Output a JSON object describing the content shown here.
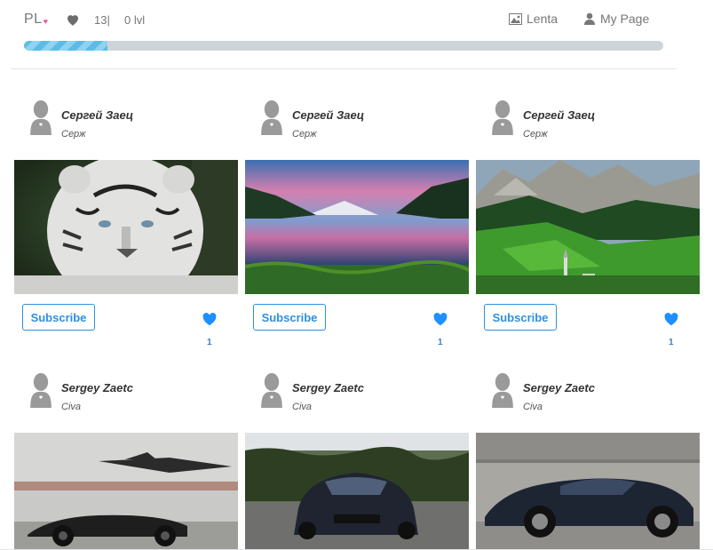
{
  "header": {
    "logo": "PL",
    "likes_count": "13|",
    "level": "0 lvl",
    "nav": [
      {
        "label": "Lenta",
        "icon": "image-icon"
      },
      {
        "label": "My Page",
        "icon": "user-icon"
      }
    ],
    "progress": 0.13
  },
  "colors": {
    "accent": "#2f8fe0",
    "progress_fill": "#5bbde3",
    "progress_track": "#cdd5d9",
    "logo_heart": "#e6559a"
  },
  "posts": [
    {
      "author_name": "Сергей Заец",
      "author_nick": "Серж",
      "photo": "white-tiger",
      "subscribe_label": "Subscribe",
      "likes": "1"
    },
    {
      "author_name": "Сергей Заец",
      "author_nick": "Серж",
      "photo": "mountain-lake-sunset",
      "subscribe_label": "Subscribe",
      "likes": "1"
    },
    {
      "author_name": "Сергей Заец",
      "author_nick": "Серж",
      "photo": "alpine-valley",
      "subscribe_label": "Subscribe",
      "likes": "1"
    },
    {
      "author_name": "Sergey Zaetc",
      "author_nick": "Civa",
      "photo": "black-car-and-stealth-jet"
    },
    {
      "author_name": "Sergey Zaetc",
      "author_nick": "Civa",
      "photo": "black-supercar-front"
    },
    {
      "author_name": "Sergey Zaetc",
      "author_nick": "Civa",
      "photo": "black-supercar-side"
    }
  ]
}
